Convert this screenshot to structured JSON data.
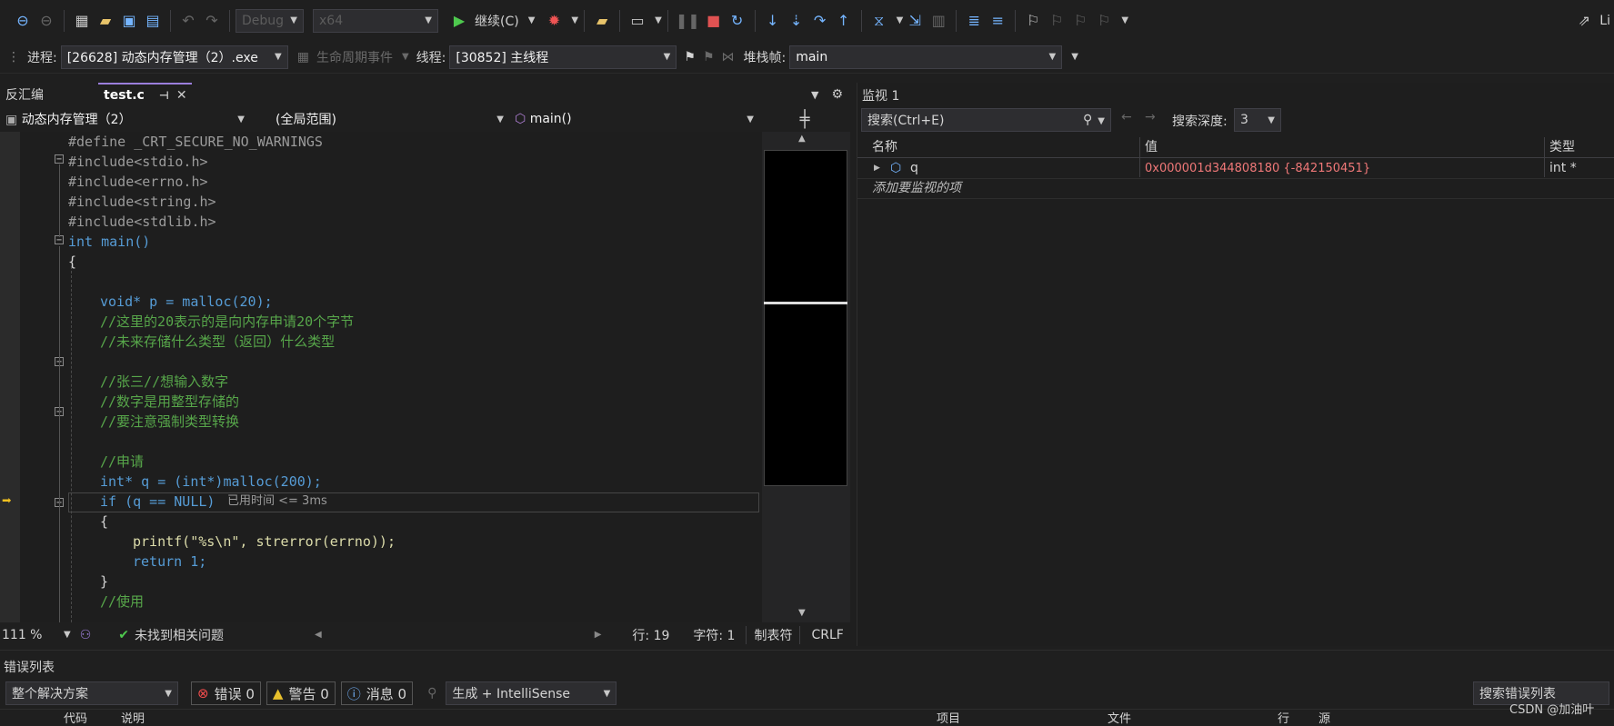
{
  "toolbar": {
    "config": "Debug",
    "platform": "x64",
    "continue_label": "继续(C)",
    "right_label": "Li"
  },
  "procbar": {
    "process_label": "进程:",
    "process_value": "[26628] 动态内存管理（2）.exe",
    "lifecycle_label": "生命周期事件",
    "thread_label": "线程:",
    "thread_value": "[30852] 主线程",
    "stack_label": "堆栈帧:",
    "stack_value": "main"
  },
  "tabs": [
    {
      "label": "反汇编"
    },
    {
      "label": "test.c"
    }
  ],
  "navbar": {
    "project": "动态内存管理（2）",
    "scope": "(全局范围)",
    "function": "main()"
  },
  "code": {
    "line1": "#define _CRT_SECURE_NO_WARNINGS",
    "line2": "#include<stdio.h>",
    "line3": "#include<errno.h>",
    "line4": "#include<string.h>",
    "line5": "#include<stdlib.h>",
    "line6": "int main()",
    "line7": "{",
    "line8": "void* p = malloc(20);",
    "line9": "//这里的20表示的是向内存申请20个字节",
    "line10": "//未来存储什么类型（返回）什么类型",
    "line11": "//张三//想输入数字",
    "line12": "//数字是用整型存储的",
    "line13": "//要注意强制类型转换",
    "line14": "//申请",
    "line15": "int* q = (int*)malloc(200);",
    "line16": "if (q == NULL)",
    "line16_hint": "已用时间 <= 3ms",
    "line17": "{",
    "line18": "printf(\"%s\\n\", strerror(errno));",
    "line19": "return 1;",
    "line20": "}",
    "line21": "//使用"
  },
  "status": {
    "zoom": "111 %",
    "issues": "未找到相关问题",
    "line": "行: 19",
    "char": "字符: 1",
    "tabs": "制表符",
    "eol": "CRLF"
  },
  "watch": {
    "title": "监视 1",
    "search_placeholder": "搜索(Ctrl+E)",
    "depth_label": "搜索深度:",
    "depth_value": "3",
    "col_name": "名称",
    "col_value": "值",
    "col_type": "类型",
    "rows": [
      {
        "name": "q",
        "value": "0x000001d344808180 {-842150451}",
        "type": "int *"
      }
    ],
    "add_hint": "添加要监视的项"
  },
  "errorlist": {
    "title": "错误列表",
    "scope": "整个解决方案",
    "errors": "错误 0",
    "warnings": "警告 0",
    "messages": "消息 0",
    "source": "生成 + IntelliSense",
    "search": "搜索错误列表",
    "col_code": "代码",
    "col_desc": "说明",
    "col_project": "项目",
    "col_file": "文件",
    "col_line": "行",
    "col_src": "源"
  },
  "watermark": "CSDN @加油叶"
}
